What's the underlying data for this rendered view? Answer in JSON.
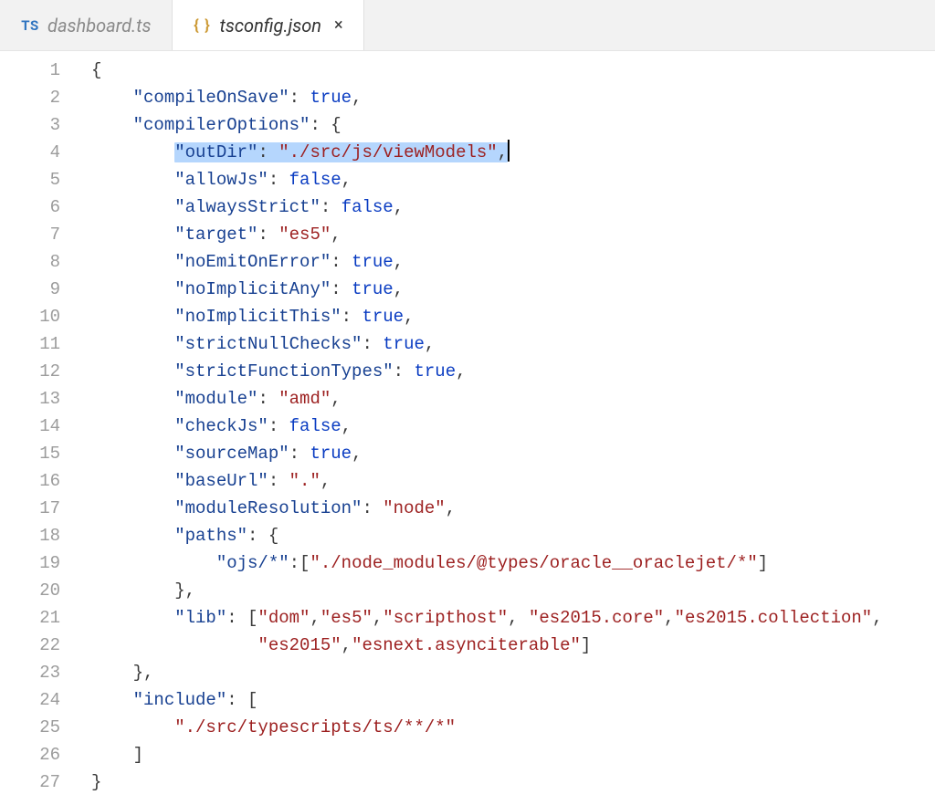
{
  "tabs": [
    {
      "icon": "ts-icon",
      "label": "dashboard.ts",
      "active": false,
      "closeable": false
    },
    {
      "icon": "json-icon",
      "label": "tsconfig.json",
      "active": true,
      "closeable": true
    }
  ],
  "closeGlyph": "×",
  "icons": {
    "ts": "TS",
    "json": "{ }"
  },
  "lineCount": 27,
  "selectedLine": 4,
  "code": {
    "tsconfig": {
      "compileOnSave": true,
      "compilerOptions": {
        "outDir": "./src/js/viewModels",
        "allowJs": false,
        "alwaysStrict": false,
        "target": "es5",
        "noEmitOnError": true,
        "noImplicitAny": true,
        "noImplicitThis": true,
        "strictNullChecks": true,
        "strictFunctionTypes": true,
        "module": "amd",
        "checkJs": false,
        "sourceMap": true,
        "baseUrl": ".",
        "moduleResolution": "node",
        "paths": {
          "ojs/*": [
            "./node_modules/@types/oracle__oraclejet/*"
          ]
        },
        "lib": [
          "dom",
          "es5",
          "scripthost",
          "es2015.core",
          "es2015.collection",
          "es2015",
          "esnext.asynciterable"
        ]
      },
      "include": [
        "./src/typescripts/ts/**/*"
      ]
    }
  },
  "lines": [
    {
      "n": 1,
      "i": 0,
      "t": [
        {
          "c": "p",
          "v": "{"
        }
      ]
    },
    {
      "n": 2,
      "i": 1,
      "t": [
        {
          "c": "k",
          "v": "\"compileOnSave\""
        },
        {
          "c": "p",
          "v": ": "
        },
        {
          "c": "b",
          "v": "true"
        },
        {
          "c": "p",
          "v": ","
        }
      ]
    },
    {
      "n": 3,
      "i": 1,
      "t": [
        {
          "c": "k",
          "v": "\"compilerOptions\""
        },
        {
          "c": "p",
          "v": ": {"
        }
      ]
    },
    {
      "n": 4,
      "i": 2,
      "sel": true,
      "t": [
        {
          "c": "k",
          "v": "\"outDir\""
        },
        {
          "c": "p",
          "v": ": "
        },
        {
          "c": "s",
          "v": "\"./src/js/viewModels\""
        },
        {
          "c": "p",
          "v": ","
        }
      ]
    },
    {
      "n": 5,
      "i": 2,
      "t": [
        {
          "c": "k",
          "v": "\"allowJs\""
        },
        {
          "c": "p",
          "v": ": "
        },
        {
          "c": "b",
          "v": "false"
        },
        {
          "c": "p",
          "v": ","
        }
      ]
    },
    {
      "n": 6,
      "i": 2,
      "t": [
        {
          "c": "k",
          "v": "\"alwaysStrict\""
        },
        {
          "c": "p",
          "v": ": "
        },
        {
          "c": "b",
          "v": "false"
        },
        {
          "c": "p",
          "v": ","
        }
      ]
    },
    {
      "n": 7,
      "i": 2,
      "t": [
        {
          "c": "k",
          "v": "\"target\""
        },
        {
          "c": "p",
          "v": ": "
        },
        {
          "c": "s",
          "v": "\"es5\""
        },
        {
          "c": "p",
          "v": ","
        }
      ]
    },
    {
      "n": 8,
      "i": 2,
      "t": [
        {
          "c": "k",
          "v": "\"noEmitOnError\""
        },
        {
          "c": "p",
          "v": ": "
        },
        {
          "c": "b",
          "v": "true"
        },
        {
          "c": "p",
          "v": ","
        }
      ]
    },
    {
      "n": 9,
      "i": 2,
      "t": [
        {
          "c": "k",
          "v": "\"noImplicitAny\""
        },
        {
          "c": "p",
          "v": ": "
        },
        {
          "c": "b",
          "v": "true"
        },
        {
          "c": "p",
          "v": ","
        }
      ]
    },
    {
      "n": 10,
      "i": 2,
      "t": [
        {
          "c": "k",
          "v": "\"noImplicitThis\""
        },
        {
          "c": "p",
          "v": ": "
        },
        {
          "c": "b",
          "v": "true"
        },
        {
          "c": "p",
          "v": ","
        }
      ]
    },
    {
      "n": 11,
      "i": 2,
      "t": [
        {
          "c": "k",
          "v": "\"strictNullChecks\""
        },
        {
          "c": "p",
          "v": ": "
        },
        {
          "c": "b",
          "v": "true"
        },
        {
          "c": "p",
          "v": ","
        }
      ]
    },
    {
      "n": 12,
      "i": 2,
      "t": [
        {
          "c": "k",
          "v": "\"strictFunctionTypes\""
        },
        {
          "c": "p",
          "v": ": "
        },
        {
          "c": "b",
          "v": "true"
        },
        {
          "c": "p",
          "v": ","
        }
      ]
    },
    {
      "n": 13,
      "i": 2,
      "t": [
        {
          "c": "k",
          "v": "\"module\""
        },
        {
          "c": "p",
          "v": ": "
        },
        {
          "c": "s",
          "v": "\"amd\""
        },
        {
          "c": "p",
          "v": ","
        }
      ]
    },
    {
      "n": 14,
      "i": 2,
      "t": [
        {
          "c": "k",
          "v": "\"checkJs\""
        },
        {
          "c": "p",
          "v": ": "
        },
        {
          "c": "b",
          "v": "false"
        },
        {
          "c": "p",
          "v": ","
        }
      ]
    },
    {
      "n": 15,
      "i": 2,
      "t": [
        {
          "c": "k",
          "v": "\"sourceMap\""
        },
        {
          "c": "p",
          "v": ": "
        },
        {
          "c": "b",
          "v": "true"
        },
        {
          "c": "p",
          "v": ","
        }
      ]
    },
    {
      "n": 16,
      "i": 2,
      "t": [
        {
          "c": "k",
          "v": "\"baseUrl\""
        },
        {
          "c": "p",
          "v": ": "
        },
        {
          "c": "s",
          "v": "\".\""
        },
        {
          "c": "p",
          "v": ","
        }
      ]
    },
    {
      "n": 17,
      "i": 2,
      "t": [
        {
          "c": "k",
          "v": "\"moduleResolution\""
        },
        {
          "c": "p",
          "v": ": "
        },
        {
          "c": "s",
          "v": "\"node\""
        },
        {
          "c": "p",
          "v": ","
        }
      ]
    },
    {
      "n": 18,
      "i": 2,
      "t": [
        {
          "c": "k",
          "v": "\"paths\""
        },
        {
          "c": "p",
          "v": ": {"
        }
      ]
    },
    {
      "n": 19,
      "i": 3,
      "t": [
        {
          "c": "k",
          "v": "\"ojs/*\""
        },
        {
          "c": "p",
          "v": ":["
        },
        {
          "c": "s",
          "v": "\"./node_modules/@types/oracle__oraclejet/*\""
        },
        {
          "c": "p",
          "v": "]"
        }
      ]
    },
    {
      "n": 20,
      "i": 2,
      "t": [
        {
          "c": "p",
          "v": "},"
        }
      ]
    },
    {
      "n": 21,
      "i": 2,
      "t": [
        {
          "c": "k",
          "v": "\"lib\""
        },
        {
          "c": "p",
          "v": ": ["
        },
        {
          "c": "s",
          "v": "\"dom\""
        },
        {
          "c": "p",
          "v": ","
        },
        {
          "c": "s",
          "v": "\"es5\""
        },
        {
          "c": "p",
          "v": ","
        },
        {
          "c": "s",
          "v": "\"scripthost\""
        },
        {
          "c": "p",
          "v": ", "
        },
        {
          "c": "s",
          "v": "\"es2015.core\""
        },
        {
          "c": "p",
          "v": ","
        },
        {
          "c": "s",
          "v": "\"es2015.collection\""
        },
        {
          "c": "p",
          "v": ","
        }
      ]
    },
    {
      "n": 22,
      "i": 4,
      "t": [
        {
          "c": "s",
          "v": "\"es2015\""
        },
        {
          "c": "p",
          "v": ","
        },
        {
          "c": "s",
          "v": "\"esnext.asynciterable\""
        },
        {
          "c": "p",
          "v": "]"
        }
      ]
    },
    {
      "n": 23,
      "i": 1,
      "t": [
        {
          "c": "p",
          "v": "},"
        }
      ]
    },
    {
      "n": 24,
      "i": 1,
      "t": [
        {
          "c": "k",
          "v": "\"include\""
        },
        {
          "c": "p",
          "v": ": ["
        }
      ]
    },
    {
      "n": 25,
      "i": 2,
      "t": [
        {
          "c": "s",
          "v": "\"./src/typescripts/ts/**/*\""
        }
      ]
    },
    {
      "n": 26,
      "i": 1,
      "t": [
        {
          "c": "p",
          "v": "]"
        }
      ]
    },
    {
      "n": 27,
      "i": 0,
      "t": [
        {
          "c": "p",
          "v": "}"
        }
      ]
    }
  ]
}
